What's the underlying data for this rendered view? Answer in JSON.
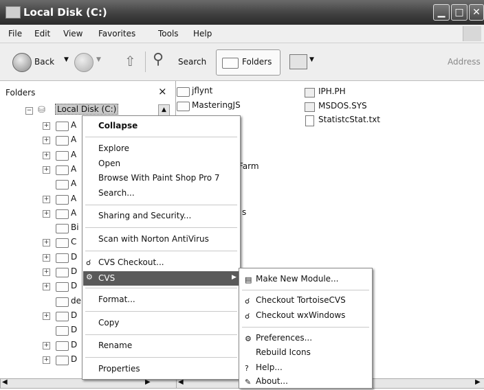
{
  "window": {
    "title": "Local Disk (C:)"
  },
  "menubar": [
    "File",
    "Edit",
    "View",
    "Favorites",
    "Tools",
    "Help"
  ],
  "toolbar": {
    "back_label": "Back",
    "search_label": "Search",
    "folders_label": "Folders",
    "address_label": "Address"
  },
  "folders_pane": {
    "title": "Folders",
    "close_glyph": "×",
    "root_label": "Local Disk (C:)",
    "rows": [
      "A",
      "A",
      "A",
      "A",
      "A",
      "A",
      "A",
      "Bi",
      "C",
      "D",
      "D",
      "D",
      "de",
      "D",
      "D",
      "D",
      "D"
    ]
  },
  "files": {
    "col1": [
      "jflynt",
      "MasteringJS"
    ],
    "col2": [
      "IPH.PH",
      "MSDOS.SYS",
      "StatistcStat.txt"
    ],
    "partial_farm": "Farm",
    "partial_s": "s"
  },
  "context_menu": {
    "collapse": "Collapse",
    "explore": "Explore",
    "open": "Open",
    "browse_psp": "Browse With Paint Shop Pro 7",
    "search": "Search...",
    "sharing": "Sharing and Security...",
    "norton": "Scan with Norton AntiVirus",
    "cvs_checkout": "CVS Checkout...",
    "cvs": "CVS",
    "format": "Format...",
    "copy": "Copy",
    "rename": "Rename",
    "properties": "Properties"
  },
  "cvs_submenu": {
    "make_module": "Make New Module...",
    "checkout_tortoise": "Checkout TortoiseCVS",
    "checkout_wx": "Checkout wxWindows",
    "preferences": "Preferences...",
    "rebuild_icons": "Rebuild Icons",
    "help": "Help...",
    "about": "About..."
  }
}
